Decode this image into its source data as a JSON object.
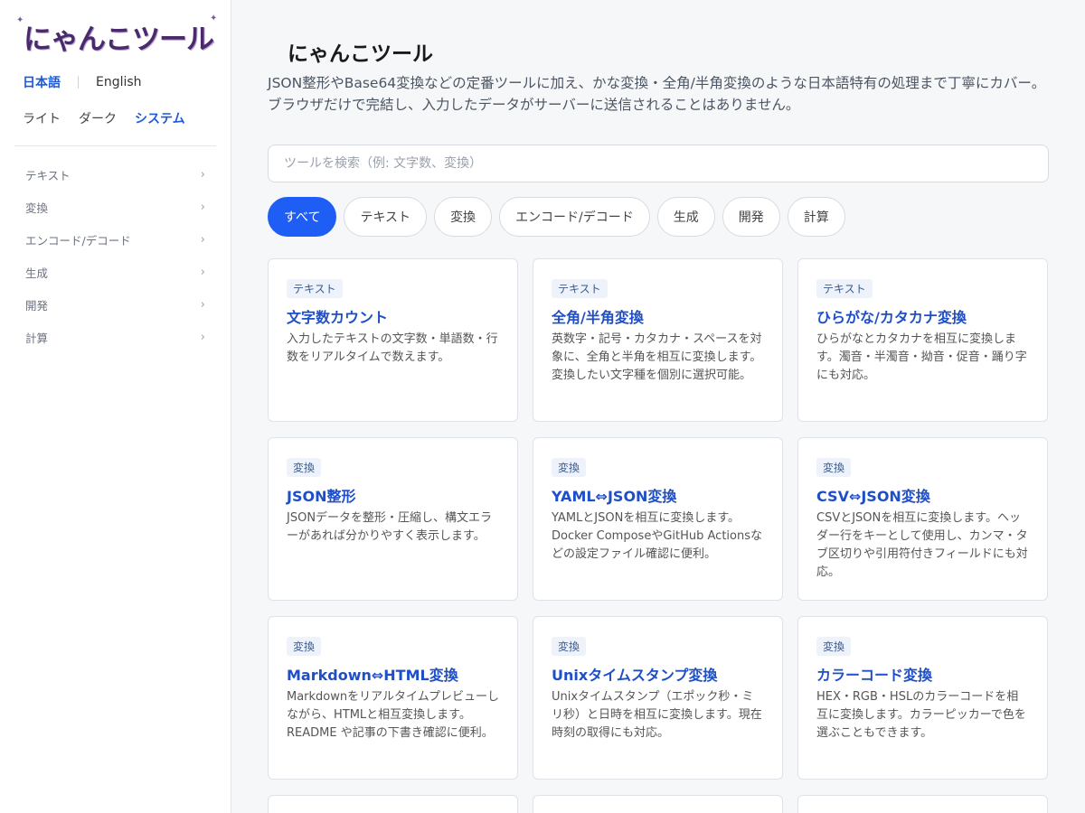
{
  "sidebar": {
    "logo_text": "にゃんこツール",
    "lang": {
      "ja": "日本語",
      "en": "English"
    },
    "theme": {
      "light": "ライト",
      "dark": "ダーク",
      "system": "システム"
    },
    "nav": [
      {
        "label": "テキスト",
        "icon": "chevron-right-icon"
      },
      {
        "label": "変換",
        "icon": "chevron-right-icon"
      },
      {
        "label": "エンコード/デコード",
        "icon": "chevron-right-icon"
      },
      {
        "label": "生成",
        "icon": "chevron-right-icon"
      },
      {
        "label": "開発",
        "icon": "chevron-right-icon"
      },
      {
        "label": "計算",
        "icon": "chevron-right-icon"
      }
    ]
  },
  "main": {
    "title": "にゃんこツール",
    "description": "JSON整形やBase64変換などの定番ツールに加え、かな変換・全角/半角変換のような日本語特有の処理まで丁寧にカバー。ブラウザだけで完結し、入力したデータがサーバーに送信されることはありません。",
    "search": {
      "placeholder": "ツールを検索（例: 文字数、変換）",
      "value": ""
    },
    "filters": [
      {
        "label": "すべて",
        "active": true
      },
      {
        "label": "テキスト",
        "active": false
      },
      {
        "label": "変換",
        "active": false
      },
      {
        "label": "エンコード/デコード",
        "active": false
      },
      {
        "label": "生成",
        "active": false
      },
      {
        "label": "開発",
        "active": false
      },
      {
        "label": "計算",
        "active": false
      }
    ],
    "cards": [
      {
        "tag": "テキスト",
        "title": "文字数カウント",
        "desc": "入力したテキストの文字数・単語数・行数をリアルタイムで数えます。"
      },
      {
        "tag": "テキスト",
        "title": "全角/半角変換",
        "desc": "英数字・記号・カタカナ・スペースを対象に、全角と半角を相互に変換します。変換したい文字種を個別に選択可能。"
      },
      {
        "tag": "テキスト",
        "title": "ひらがな/カタカナ変換",
        "desc": "ひらがなとカタカナを相互に変換します。濁音・半濁音・拗音・促音・踊り字にも対応。"
      },
      {
        "tag": "変換",
        "title": "JSON整形",
        "desc": "JSONデータを整形・圧縮し、構文エラーがあれば分かりやすく表示します。"
      },
      {
        "tag": "変換",
        "title": "YAML⇔JSON変換",
        "desc": "YAMLとJSONを相互に変換します。Docker ComposeやGitHub Actionsなどの設定ファイル確認に便利。"
      },
      {
        "tag": "変換",
        "title": "CSV⇔JSON変換",
        "desc": "CSVとJSONを相互に変換します。ヘッダー行をキーとして使用し、カンマ・タブ区切りや引用符付きフィールドにも対応。"
      },
      {
        "tag": "変換",
        "title": "Markdown⇔HTML変換",
        "desc": "Markdownをリアルタイムプレビューしながら、HTMLと相互変換します。README や記事の下書き確認に便利。"
      },
      {
        "tag": "変換",
        "title": "Unixタイムスタンプ変換",
        "desc": "Unixタイムスタンプ（エポック秒・ミリ秒）と日時を相互に変換します。現在時刻の取得にも対応。"
      },
      {
        "tag": "変換",
        "title": "カラーコード変換",
        "desc": "HEX・RGB・HSLのカラーコードを相互に変換します。カラーピッカーで色を選ぶこともできます。"
      }
    ]
  },
  "colors": {
    "accent": "#1f5ef5",
    "link": "#1f4fc7",
    "logo": "#4a2a6b",
    "background": "#f6f7f9"
  }
}
